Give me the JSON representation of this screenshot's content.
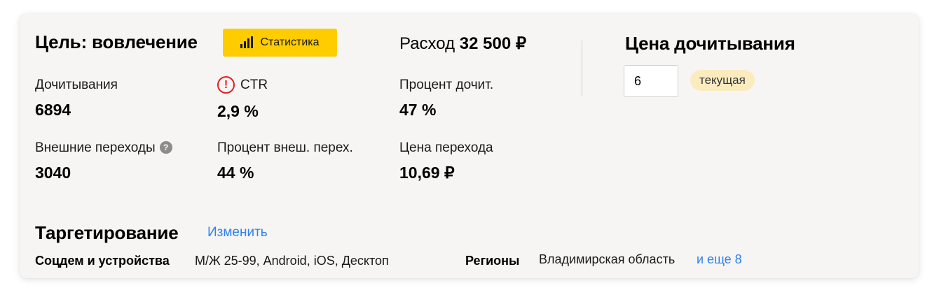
{
  "header": {
    "goal_title": "Цель: вовлечение",
    "stats_button": "Статистика",
    "spend_label": "Расход",
    "spend_value": "32 500 ₽"
  },
  "metrics": [
    {
      "label": "Дочитывания",
      "value": "6894"
    },
    {
      "label": "CTR",
      "value": "2,9 %",
      "warning": true
    },
    {
      "label": "Процент дочит.",
      "value": "47 %"
    },
    {
      "label": "Внешние переходы",
      "value": "3040",
      "help": "?"
    },
    {
      "label": "Процент внеш. перех.",
      "value": "44 %"
    },
    {
      "label": "Цена перехода",
      "value": "10,69 ₽"
    }
  ],
  "price": {
    "title": "Цена дочитывания",
    "input_value": "6",
    "badge": "текущая"
  },
  "targeting": {
    "title": "Таргетирование",
    "change_link": "Изменить",
    "socdem_label": "Соцдем и устройства",
    "socdem_value": "М/Ж 25-99, Android, iOS, Десктоп",
    "regions_label": "Регионы",
    "regions_value": "Владимирская область",
    "regions_more": "и еще 8"
  },
  "icons": {
    "stats": "bar-chart-icon",
    "warning": "warning-circle-icon",
    "help": "question-circle-icon"
  },
  "colors": {
    "accent_yellow": "#ffcc00",
    "link_blue": "#2f82f0",
    "warning_red": "#e02020",
    "badge_bg": "#fbecbf",
    "card_bg": "#f6f5f3"
  }
}
